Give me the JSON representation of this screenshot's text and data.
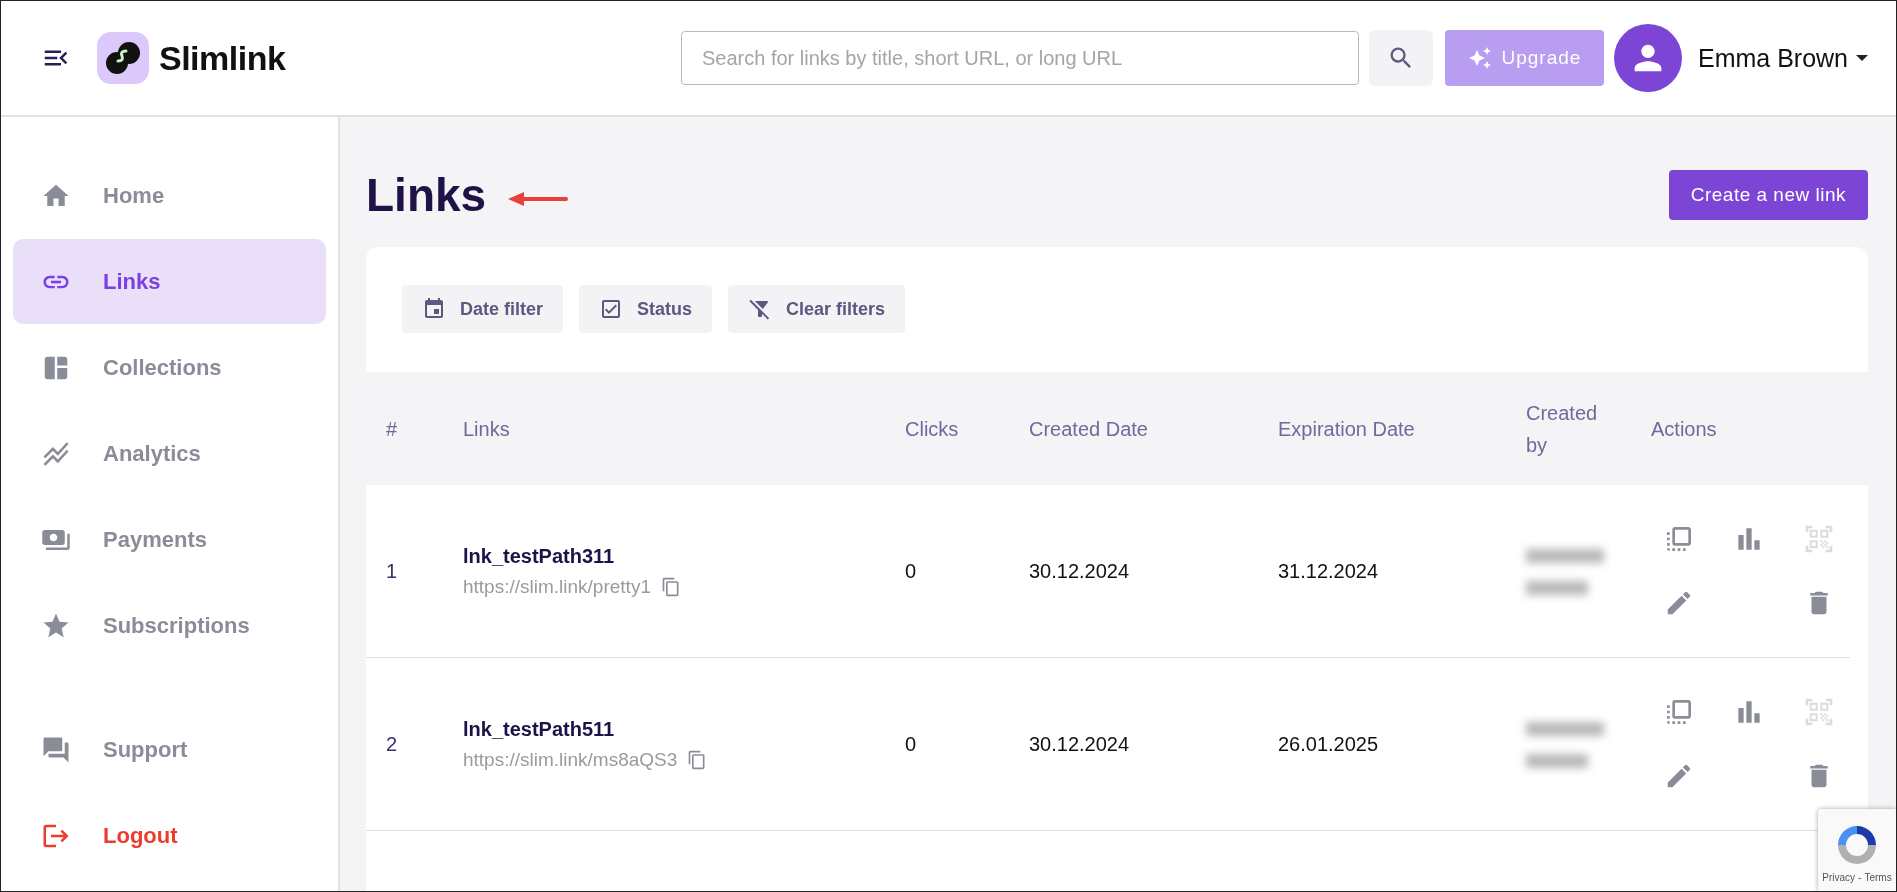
{
  "header": {
    "brand": "Slimlink",
    "search": {
      "placeholder": "Search for links by title, short URL, or long URL"
    },
    "upgrade": "Upgrade",
    "user": "Emma Brown"
  },
  "sidebar": {
    "items": [
      {
        "label": "Home",
        "kind": "nav",
        "selected": false
      },
      {
        "label": "Links",
        "kind": "nav",
        "selected": true
      },
      {
        "label": "Collections",
        "kind": "nav",
        "selected": false
      },
      {
        "label": "Analytics",
        "kind": "nav",
        "selected": false
      },
      {
        "label": "Payments",
        "kind": "nav",
        "selected": false
      },
      {
        "label": "Subscriptions",
        "kind": "nav",
        "selected": false
      },
      {
        "label": "Support",
        "kind": "nav",
        "selected": false
      },
      {
        "label": "Logout",
        "kind": "danger",
        "selected": false
      }
    ]
  },
  "page": {
    "title": "Links",
    "create_button": "Create a new link"
  },
  "filters": [
    {
      "label": "Date filter"
    },
    {
      "label": "Status"
    },
    {
      "label": "Clear filters"
    }
  ],
  "table": {
    "columns": [
      "#",
      "Links",
      "Clicks",
      "Created Date",
      "Expiration Date",
      "Created by",
      "Actions"
    ],
    "rows": [
      {
        "index": "1",
        "title": "lnk_testPath311",
        "url": "https://slim.link/pretty1",
        "clicks": "0",
        "created": "30.12.2024",
        "expires": "31.12.2024",
        "qr_disabled": true
      },
      {
        "index": "2",
        "title": "lnk_testPath511",
        "url": "https://slim.link/ms8aQS3",
        "clicks": "0",
        "created": "30.12.2024",
        "expires": "26.01.2025",
        "qr_disabled": true
      }
    ]
  },
  "recaptcha": {
    "privacy": "Privacy",
    "separator": "-",
    "terms": "Terms"
  }
}
